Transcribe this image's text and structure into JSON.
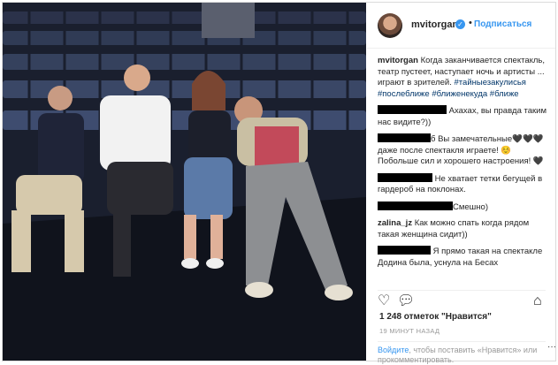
{
  "post": {
    "username": "mvitorgan",
    "follow_label": "Подписаться",
    "caption_user": "mvitorgan",
    "caption_text": "Когда заканчивается спектакль, театр пустеет, наступает ночь и артисты ... играют в зрителей.",
    "caption_tags": "#тайныезакулисья #послеближе #ближенекуда #ближе",
    "comments": [
      {
        "text": "Ахахах, вы правда таким нас видите?))"
      },
      {
        "text": "б Вы замечательные🖤🖤🖤 даже после спектакля играете! ☺️ Побольше сил и хорошего настроения! 🖤"
      },
      {
        "text": "Не хватает тетки бегущей в гардероб на поклонах."
      },
      {
        "text": "Смешно)"
      },
      {
        "user": "zalina_jz",
        "text": "Как можно спать когда рядом такая женщина сидит))"
      },
      {
        "text": "Я прямо такая на спектакле Додина была, уснула на Бесах"
      }
    ],
    "likes": "1 248 отметок \"Нравится\"",
    "timestamp": "19 МИНУТ НАЗАД",
    "login_link": "Войдите",
    "login_text": ", чтобы поставить «Нравится» или прокомментировать.",
    "more": "···"
  }
}
